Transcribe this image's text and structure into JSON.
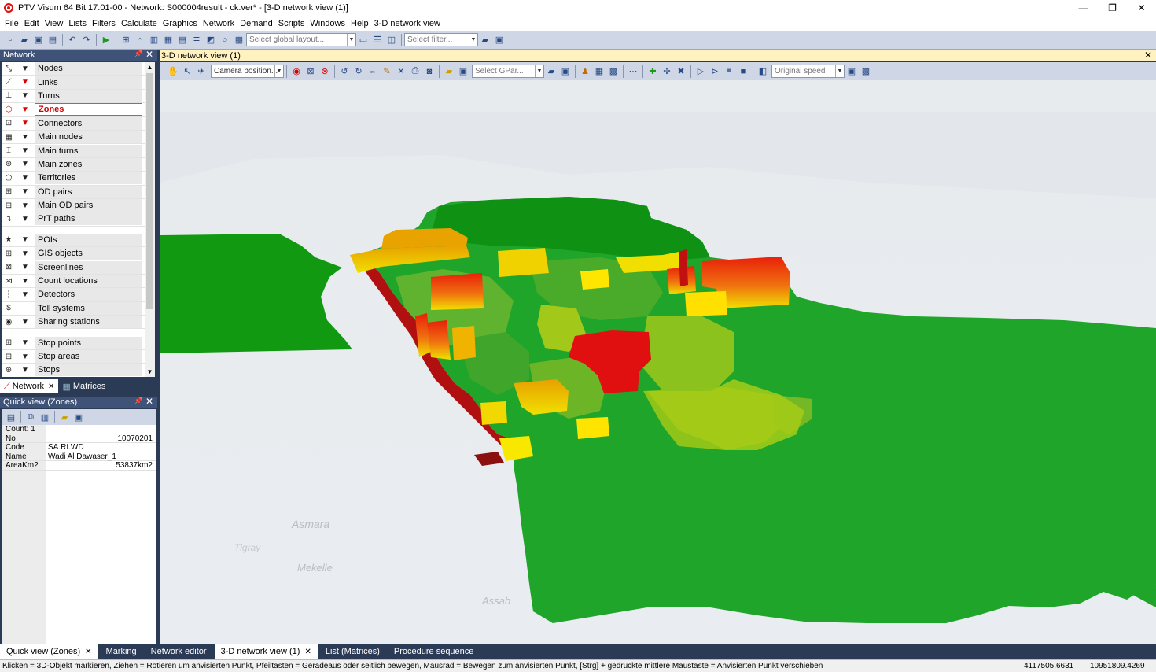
{
  "window": {
    "title": "PTV Visum 64 Bit 17.01-00 - Network: S000004result - ck.ver* - [3-D network view (1)]",
    "minimize": "—",
    "maximize": "❐",
    "close": "✕"
  },
  "menu": [
    "File",
    "Edit",
    "View",
    "Lists",
    "Filters",
    "Calculate",
    "Graphics",
    "Network",
    "Demand",
    "Scripts",
    "Windows",
    "Help",
    "3-D network view"
  ],
  "toolbar": {
    "layout_placeholder": "Select global layout...",
    "filter_placeholder": "Select filter..."
  },
  "network_pane": {
    "title": "Network",
    "items": [
      {
        "label": "Nodes",
        "icon": "node-icon",
        "filter_red": false
      },
      {
        "label": "Links",
        "icon": "link-icon",
        "filter_red": true
      },
      {
        "label": "Turns",
        "icon": "turn-icon",
        "filter_red": false
      },
      {
        "label": "Zones",
        "icon": "zone-icon",
        "filter_red": true,
        "selected": true
      },
      {
        "label": "Connectors",
        "icon": "connector-icon",
        "filter_red": true
      },
      {
        "label": "Main nodes",
        "icon": "main-node-icon",
        "filter_red": false
      },
      {
        "label": "Main turns",
        "icon": "main-turn-icon",
        "filter_red": false
      },
      {
        "label": "Main zones",
        "icon": "main-zone-icon",
        "filter_red": false
      },
      {
        "label": "Territories",
        "icon": "territory-icon",
        "filter_red": false
      },
      {
        "label": "OD pairs",
        "icon": "od-pair-icon",
        "filter_red": false
      },
      {
        "label": "Main OD pairs",
        "icon": "main-od-pair-icon",
        "filter_red": false
      },
      {
        "label": "PrT paths",
        "icon": "prt-path-icon",
        "filter_red": false
      },
      {
        "label": "POIs",
        "icon": "poi-icon",
        "filter_red": false,
        "gap_before": true
      },
      {
        "label": "GIS objects",
        "icon": "gis-icon",
        "filter_red": false
      },
      {
        "label": "Screenlines",
        "icon": "screenline-icon",
        "filter_red": false
      },
      {
        "label": "Count locations",
        "icon": "count-location-icon",
        "filter_red": false
      },
      {
        "label": "Detectors",
        "icon": "detector-icon",
        "filter_red": false
      },
      {
        "label": "Toll systems",
        "icon": "toll-icon",
        "filter_red": false,
        "no_filter": true
      },
      {
        "label": "Sharing stations",
        "icon": "sharing-station-icon",
        "filter_red": false
      },
      {
        "label": "Stop points",
        "icon": "stop-point-icon",
        "filter_red": false,
        "gap_before": true
      },
      {
        "label": "Stop areas",
        "icon": "stop-area-icon",
        "filter_red": false
      },
      {
        "label": "Stops",
        "icon": "stop-icon",
        "filter_red": false
      }
    ],
    "tabs": [
      "Network",
      "Matrices"
    ]
  },
  "quick_view": {
    "title": "Quick view (Zones)",
    "count": "Count: 1",
    "rows": [
      {
        "key": "No",
        "value": "10070201",
        "align": "right"
      },
      {
        "key": "Code",
        "value": "SA.RI.WD",
        "align": "left"
      },
      {
        "key": "Name",
        "value": "Wadi Al Dawaser_1",
        "align": "left"
      },
      {
        "key": "AreaKm2",
        "value": "53837km2",
        "align": "right"
      }
    ]
  },
  "view": {
    "title": "3-D network view (1)",
    "camera_combo": "Camera position...",
    "gpar_combo": "Select GPar...",
    "speed_combo": "Original speed"
  },
  "map_labels": [
    "Asmara",
    "Mekelle",
    "Tigray",
    "Assab"
  ],
  "bottom_tabs": [
    {
      "label": "Quick view (Zones)",
      "active": true,
      "closable": true
    },
    {
      "label": "Marking",
      "active": false,
      "closable": false
    },
    {
      "label": "Network editor",
      "active": false,
      "closable": false
    },
    {
      "label": "3-D network view (1)",
      "active": true,
      "closable": true
    },
    {
      "label": "List (Matrices)",
      "active": false,
      "closable": false
    },
    {
      "label": "Procedure sequence",
      "active": false,
      "closable": false
    }
  ],
  "status": {
    "hint": "Klicken = 3D-Objekt markieren, Ziehen = Rotieren um anvisierten Punkt, Pfeiltasten = Geradeaus oder seitlich bewegen, Mausrad = Bewegen zum anvisierten Punkt, [Strg] + gedrückte mittlere Maustaste = Anvisierten Punkt verschieben",
    "coord_x": "4117505.6631",
    "coord_y": "10951809.4269"
  },
  "colors": {
    "accent": "#2b3a55",
    "high": "#e61e00",
    "mid": "#f0a000",
    "low": "#1f9a1f"
  }
}
